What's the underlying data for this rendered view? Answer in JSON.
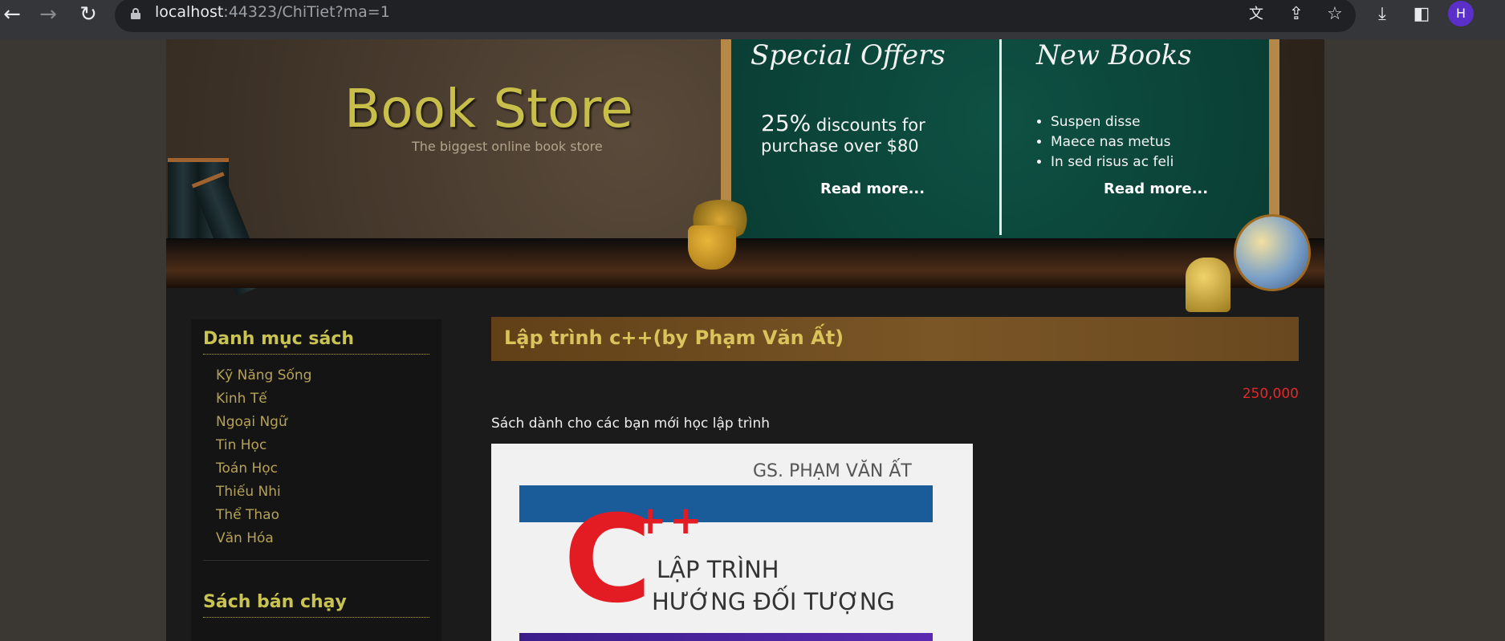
{
  "browser": {
    "url_host": "localhost",
    "url_path": ":44323/ChiTiet?ma=1",
    "profile_initial": "H",
    "icons": [
      "back-arrow-icon",
      "forward-arrow-icon",
      "reload-icon",
      "lock-icon",
      "translate-icon",
      "share-icon",
      "star-icon",
      "download-icon",
      "sidepanel-icon"
    ]
  },
  "header": {
    "logo_title": "Book Store",
    "logo_tagline": "The biggest online book store",
    "special_offers": {
      "heading": "Special Offers",
      "percent": "25%",
      "line1_rest": " discounts for",
      "line2": "purchase over $80",
      "read_more": "Read more..."
    },
    "new_books": {
      "heading": "New Books",
      "items": [
        "Suspen disse",
        "Maece nas metus",
        "In sed risus ac feli"
      ],
      "read_more": "Read more..."
    }
  },
  "sidebar": {
    "categories_heading": "Danh mục sách",
    "categories": [
      "Kỹ Năng Sống",
      "Kinh Tế",
      "Ngoại Ngữ",
      "Tin Học",
      "Toán Học",
      "Thiếu Nhi",
      "Thể Thao",
      "Văn Hóa"
    ],
    "bestsellers_heading": "Sách bán chạy"
  },
  "product": {
    "title": "Lập trình c++(by Phạm Văn Ất)",
    "price": "250,000",
    "description": "Sách dành cho các bạn mới học lập trình",
    "cover": {
      "author": "GS. PHẠM VĂN ẤT",
      "letter": "C",
      "plus": "+",
      "line1": "LẬP TRÌNH",
      "line2": "HƯỚNG ĐỐI TƯỢNG"
    }
  },
  "colors": {
    "accent_yellow": "#c9c351",
    "price_red": "#e3282a",
    "title_bar_brown": "#7a5626",
    "chalkboard_green": "#0a3d33"
  }
}
